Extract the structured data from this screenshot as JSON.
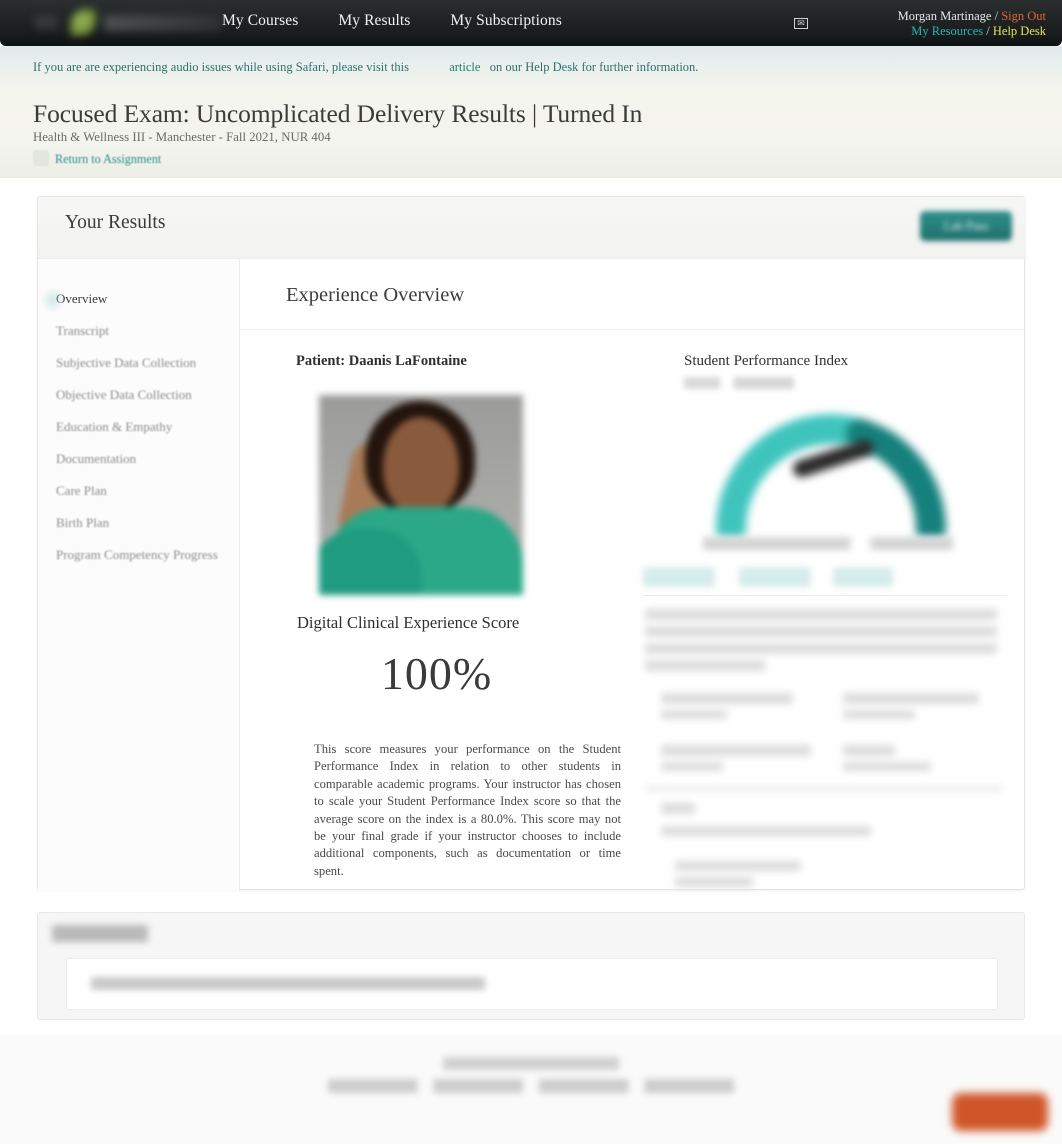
{
  "topnav": {
    "brand_name": "Shadow Health",
    "links": [
      {
        "label": "My Courses"
      },
      {
        "label": "My Results"
      },
      {
        "label": "My Subscriptions"
      }
    ],
    "mail_icon": "envelope-icon",
    "account": {
      "username": "Morgan Martinage",
      "sign_out": "Sign Out",
      "my_resources": "My Resources",
      "help_desk": "Help Desk",
      "separator": "/"
    },
    "colors": {
      "bar_bg": "#1c2021",
      "sign_out": "#e0643a",
      "my_resources": "#2fb3ae",
      "help_desk": "#e9e455"
    }
  },
  "alert": {
    "text_before": "If you are are experiencing audio issues while using Safari, please visit this",
    "link_label": "article",
    "text_after": "on our Help Desk for further information.",
    "color": "#2e6f72"
  },
  "page": {
    "title": "Focused Exam: Uncomplicated Delivery Results | Turned In",
    "subtitle": "Health & Wellness III - Manchester - Fall 2021, NUR 404",
    "return_link": "Return to Assignment"
  },
  "results_card": {
    "header": "Your Results",
    "lab_pass_label": "Lab Pass"
  },
  "sidebar": {
    "items": [
      {
        "label": "Overview",
        "active": true
      },
      {
        "label": "Transcript",
        "active": false
      },
      {
        "label": "Subjective Data Collection",
        "active": false
      },
      {
        "label": "Objective Data Collection",
        "active": false
      },
      {
        "label": "Education & Empathy",
        "active": false
      },
      {
        "label": "Documentation",
        "active": false
      },
      {
        "label": "Care Plan",
        "active": false
      },
      {
        "label": "Birth Plan",
        "active": false
      },
      {
        "label": "Program Competency Progress",
        "active": false
      }
    ]
  },
  "content": {
    "heading": "Experience Overview",
    "patient": {
      "label": "Patient: Daanis LaFontaine",
      "photo": "patient-photo"
    },
    "dces": {
      "label": "Digital Clinical Experience Score",
      "value": "100%",
      "description": "This score measures your performance on the Student Performance Index in relation to other students in comparable academic programs. Your instructor has chosen to scale your Student Performance Index score so that the average score on the index is a 80.0%. This score may not be your final grade if your instructor chooses to include additional components, such as documentation or time spent."
    },
    "spi": {
      "label": "Student Performance Index",
      "gauge_colors": {
        "light_teal": "#3fc4bd",
        "dark_teal": "#15807c",
        "needle": "#2b2b2b"
      }
    }
  },
  "comments": {
    "title_placeholder": "comments-title-redacted",
    "body_placeholder": "comments-body-redacted"
  },
  "footer": {
    "line1_placeholder": "footer-line-1-redacted",
    "line2_placeholder": "footer-line-2-redacted",
    "chat_button": "chat-support-button",
    "chat_button_color": "#d0562a"
  }
}
